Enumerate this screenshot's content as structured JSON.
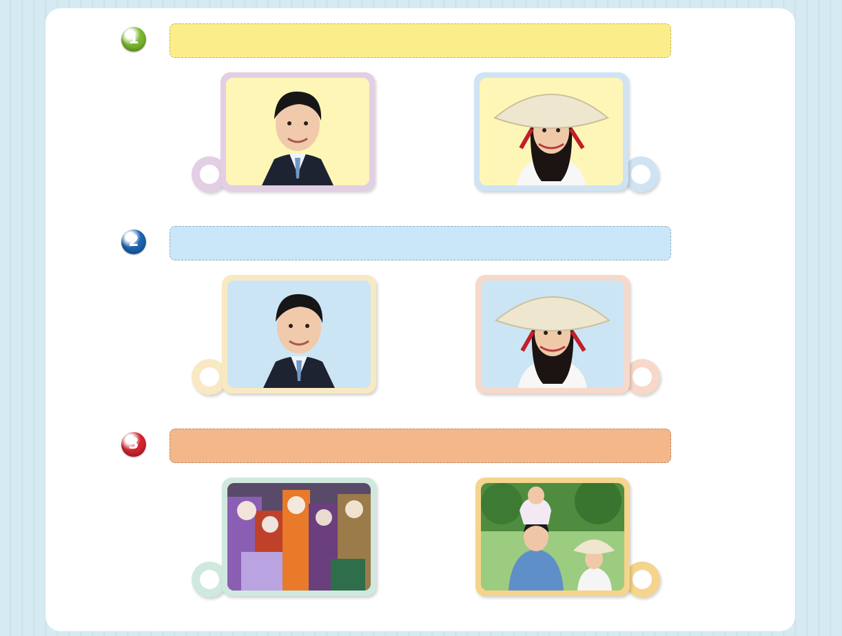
{
  "rows": [
    {
      "number": "1",
      "number_color": "#7ab62e",
      "bar_color": "#fbee8a",
      "left_tag": {
        "frame_color": "#e2cfe4",
        "bg_color": "#fdf6b6",
        "subject": "man-in-suit-photo"
      },
      "right_tag": {
        "frame_color": "#cfe3f3",
        "bg_color": "#fdf6b6",
        "subject": "woman-in-conical-hat-photo"
      }
    },
    {
      "number": "2",
      "number_color": "#1d64b0",
      "bar_color": "#c9e7f8",
      "left_tag": {
        "frame_color": "#f8e9c3",
        "bg_color": "#cce5f5",
        "subject": "man-in-suit-photo"
      },
      "right_tag": {
        "frame_color": "#f8d8c9",
        "bg_color": "#cce5f5",
        "subject": "woman-in-conical-hat-photo"
      }
    },
    {
      "number": "3",
      "number_color": "#d3232e",
      "bar_color": "#f4b78a",
      "left_tag": {
        "frame_color": "#cfe9de",
        "bg_color": "#7a5a8c",
        "subject": "carnival-costumes-photo"
      },
      "right_tag": {
        "frame_color": "#f5d48c",
        "bg_color": "#8dbf6a",
        "subject": "family-outdoors-photo"
      }
    }
  ]
}
